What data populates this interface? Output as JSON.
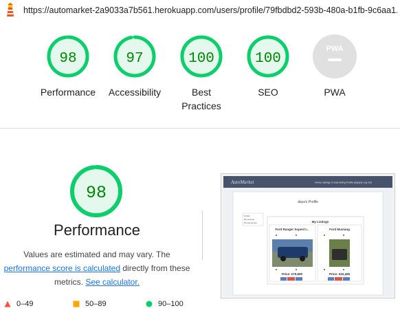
{
  "url": "https://automarket-2a9033a7b561.herokuapp.com/users/profile/79fbdbd2-593b-480a-b1fb-9c6aa1...",
  "colors": {
    "pass": "#0cce6b",
    "pass_text": "#008800",
    "average": "#ffa400",
    "fail": "#ff4e42",
    "na": "#e0e0e0"
  },
  "gauges": [
    {
      "score": "98",
      "value": 98,
      "label": "Performance"
    },
    {
      "score": "97",
      "value": 97,
      "label": "Accessibility"
    },
    {
      "score": "100",
      "value": 100,
      "label": "Best Practices"
    },
    {
      "score": "100",
      "value": 100,
      "label": "SEO"
    },
    {
      "score": "PWA",
      "label": "PWA"
    }
  ],
  "performance": {
    "score": "98",
    "value": 98,
    "title": "Performance",
    "desc_1": "Values are estimated and may vary. The",
    "link_1": "performance score is calculated",
    "desc_2": "directly from these metrics.",
    "link_2": "See calculator."
  },
  "legend": [
    {
      "range": "0–49",
      "shape": "triangle"
    },
    {
      "range": "50–89",
      "shape": "square"
    },
    {
      "range": "90–100",
      "shape": "circle"
    }
  ],
  "thumbnail": {
    "brand": "AutoMarket",
    "nav": [
      "Home",
      "Listings",
      "Create listing",
      "Profile (dayan)",
      "Log Out"
    ],
    "heading": "daya's Profile",
    "sidebar": [
      "Profile",
      "My Listings",
      "My Favourites"
    ],
    "section": "My Listings",
    "cards": [
      {
        "title": "Ford Ranger SuperCr...",
        "price": "Price: €70,500"
      },
      {
        "title": "Ford Mustang",
        "price": "Price: €22,426"
      }
    ]
  }
}
